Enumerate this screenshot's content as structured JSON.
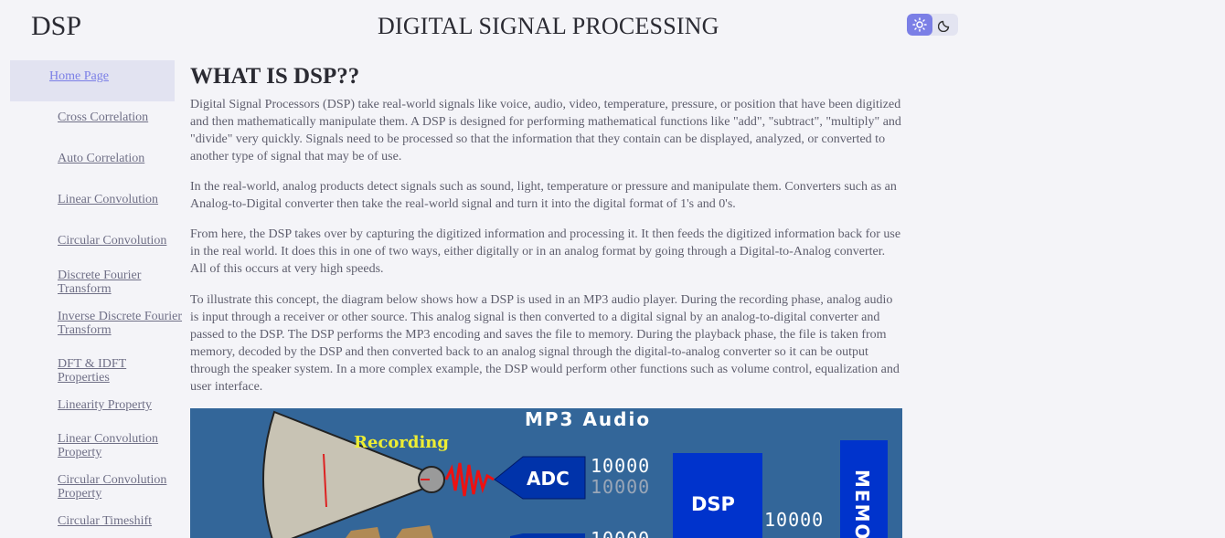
{
  "header": {
    "brand": "DSP",
    "title": "DIGITAL SIGNAL PROCESSING",
    "theme_toggle": {
      "light_icon": "sun-icon",
      "dark_icon": "moon-icon",
      "selected": "light"
    }
  },
  "sidebar": {
    "items": [
      {
        "label": "Home Page",
        "active": true
      },
      {
        "label": "Cross Correlation"
      },
      {
        "label": "Auto Correlation"
      },
      {
        "label": "Linear Convolution"
      },
      {
        "label": "Circular Convolution"
      },
      {
        "label": "Discrete Fourier Transform"
      },
      {
        "label": "Inverse Discrete Fourier Transform"
      },
      {
        "label": "DFT & IDFT Properties"
      },
      {
        "label": "Linearity Property"
      },
      {
        "label": "Linear Convolution Property"
      },
      {
        "label": "Circular Convolution Property"
      },
      {
        "label": "Circular Timeshift"
      }
    ]
  },
  "main": {
    "heading": "WHAT IS DSP??",
    "paragraphs": [
      "Digital Signal Processors (DSP) take real-world signals like voice, audio, video, temperature, pressure, or position that have been digitized and then mathematically manipulate them. A DSP is designed for performing mathematical functions like \"add\", \"subtract\", \"multiply\" and \"divide\" very quickly. Signals need to be processed so that the information that they contain can be displayed, analyzed, or converted to another type of signal that may be of use.",
      "In the real-world, analog products detect signals such as sound, light, temperature or pressure and manipulate them. Converters such as an Analog-to-Digital converter then take the real-world signal and turn it into the digital format of 1's and 0's.",
      "From here, the DSP takes over by capturing the digitized information and processing it. It then feeds the digitized information back for use in the real world. It does this in one of two ways, either digitally or in an analog format by going through a Digital-to-Analog converter. All of this occurs at very high speeds.",
      "To illustrate this concept, the diagram below shows how a DSP is used in an MP3 audio player. During the recording phase, analog audio is input through a receiver or other source. This analog signal is then converted to a digital signal by an analog-to-digital converter and passed to the DSP. The DSP performs the MP3 encoding and saves the file to memory. During the playback phase, the file is taken from memory, decoded by the DSP and then converted back to an analog signal through the digital-to-analog converter so it can be output through the speaker system. In a more complex example, the DSP would perform other functions such as volume control, equalization and user interface."
    ],
    "diagram": {
      "title": "MP3 Audio",
      "recording_label": "Recording",
      "adc_label": "ADC",
      "bits_1": "10000",
      "bits_2": "10000",
      "bits_3": "10000",
      "dsp_label": "DSP",
      "memory_label": "MEMO"
    }
  }
}
